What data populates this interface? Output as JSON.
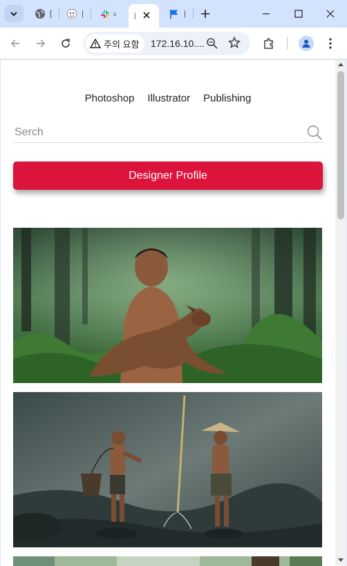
{
  "browser": {
    "tabs": [
      {
        "icon": "globe-icon",
        "label": "["
      },
      {
        "icon": "ghost-icon",
        "label": "|"
      },
      {
        "icon": "slack-icon",
        "label": "s"
      },
      {
        "icon": "page-icon",
        "label": "|",
        "active": true
      },
      {
        "icon": "flag-icon",
        "label": "|"
      }
    ],
    "security_label": "주의 요함",
    "url": "172.16.10...."
  },
  "page": {
    "nav": [
      "Photoshop",
      "Illustrator",
      "Publishing"
    ],
    "search": {
      "placeholder": "Serch",
      "value": ""
    },
    "profile_button": "Designer Profile",
    "accent_color": "#dc143c"
  },
  "photos": [
    {
      "subject": "boy-holding-goat-in-forest"
    },
    {
      "subject": "two-boys-fishing-in-river"
    },
    {
      "subject": "partial-image"
    }
  ]
}
